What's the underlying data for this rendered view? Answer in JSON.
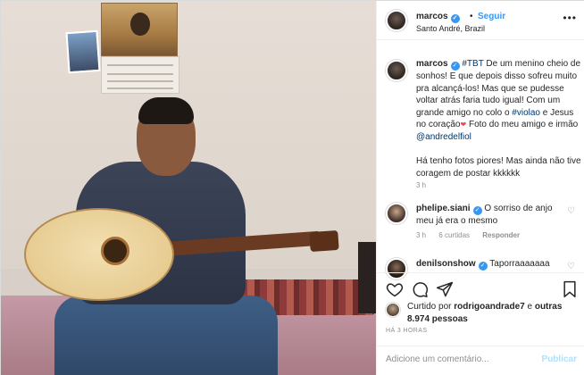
{
  "header": {
    "username": "marcos",
    "separator": "•",
    "follow_label": "Seguir",
    "location": "Santo André, Brazil",
    "more_icon": "more-icon"
  },
  "caption": {
    "username": "marcos",
    "hashtag_tbt": "#TBT",
    "text_1": " De um menino cheio de sonhos! E que depois disso sofreu muito pra alcançá-los! Mas que se pudesse voltar atrás faria tudo igual! Com um grande amigo no colo o ",
    "hashtag_violao": "#violao",
    "text_2": " e Jesus no coração",
    "text_3": " Foto do meu amigo e irmão ",
    "mention": "@andredelfiol",
    "text_4": "Há tenho fotos piores! Mas ainda não tive coragem de postar kkkkkk",
    "time": "3 h"
  },
  "comments": [
    {
      "username": "phelipe.siani",
      "text": " O sorriso de anjo meu já era o mesmo",
      "time": "3 h",
      "likes": "6 curtidas",
      "reply": "Responder"
    },
    {
      "username": "denilsonshow",
      "text": " Taporraaaaaaa"
    }
  ],
  "likes": {
    "prefix": "Curtido por ",
    "user": "rodrigoandrade7",
    "middle": " e ",
    "others": "outras 8.974 pessoas"
  },
  "time_ago": "HÁ 3 HORAS",
  "composer": {
    "placeholder": "Adicione um comentário...",
    "publish_label": "Publicar"
  },
  "colors": {
    "link_blue": "#3897f0",
    "text": "#262626",
    "muted": "#8e8e8e",
    "heart_red": "#ed4956",
    "publish_disabled": "#b2dffc"
  }
}
